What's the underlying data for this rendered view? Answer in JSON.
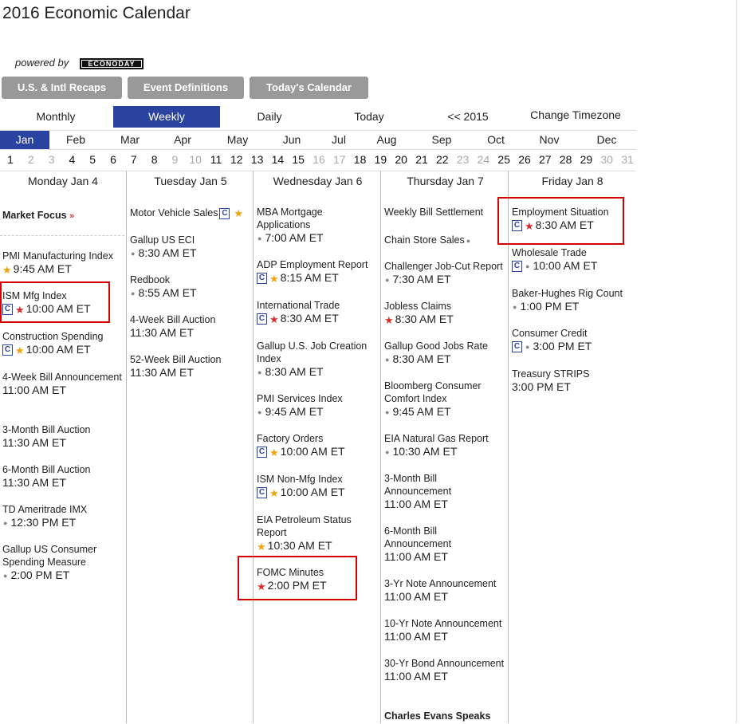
{
  "title": "2016 Economic Calendar",
  "powered_by": "powered by",
  "logo_text": "ECONODAY",
  "buttons": [
    "U.S. & Intl Recaps",
    "Event Definitions",
    "Today's Calendar"
  ],
  "views": [
    "Monthly",
    "Weekly",
    "Daily",
    "Today",
    "<< 2015",
    "Change Timezone"
  ],
  "active_view": "Weekly",
  "months": [
    "Jan",
    "Feb",
    "Mar",
    "Apr",
    "May",
    "Jun",
    "Jul",
    "Aug",
    "Sep",
    "Oct",
    "Nov",
    "Dec"
  ],
  "active_month": "Jan",
  "days": [
    {
      "n": "1",
      "dim": false
    },
    {
      "n": "2",
      "dim": true
    },
    {
      "n": "3",
      "dim": true
    },
    {
      "n": "4",
      "dim": false
    },
    {
      "n": "5",
      "dim": false
    },
    {
      "n": "6",
      "dim": false
    },
    {
      "n": "7",
      "dim": false
    },
    {
      "n": "8",
      "dim": false
    },
    {
      "n": "9",
      "dim": true
    },
    {
      "n": "10",
      "dim": true
    },
    {
      "n": "11",
      "dim": false
    },
    {
      "n": "12",
      "dim": false
    },
    {
      "n": "13",
      "dim": false
    },
    {
      "n": "14",
      "dim": false
    },
    {
      "n": "15",
      "dim": false
    },
    {
      "n": "16",
      "dim": true
    },
    {
      "n": "17",
      "dim": true
    },
    {
      "n": "18",
      "dim": false
    },
    {
      "n": "19",
      "dim": false
    },
    {
      "n": "20",
      "dim": false
    },
    {
      "n": "21",
      "dim": false
    },
    {
      "n": "22",
      "dim": false
    },
    {
      "n": "23",
      "dim": true
    },
    {
      "n": "24",
      "dim": true
    },
    {
      "n": "25",
      "dim": false
    },
    {
      "n": "26",
      "dim": false
    },
    {
      "n": "27",
      "dim": false
    },
    {
      "n": "28",
      "dim": false
    },
    {
      "n": "29",
      "dim": false
    },
    {
      "n": "30",
      "dim": true
    },
    {
      "n": "31",
      "dim": true
    }
  ],
  "columns": [
    {
      "header": "Monday Jan 4",
      "events": [
        {
          "name": "Market Focus",
          "bold": true,
          "arrow": "»",
          "time": ""
        },
        {
          "name": "PMI Manufacturing Index",
          "icons": [
            "stary"
          ],
          "time": "9:45 AM ET"
        },
        {
          "name": "ISM Mfg Index",
          "icons": [
            "c",
            "star"
          ],
          "time": "10:00 AM ET"
        },
        {
          "name": "Construction Spending",
          "icons": [
            "c",
            "stary"
          ],
          "time": "10:00 AM ET"
        },
        {
          "name": "4-Week Bill Announcement",
          "icons": [],
          "time": "11:00 AM ET"
        },
        {
          "name": "3-Month Bill Auction",
          "icons": [],
          "time": "11:30 AM ET"
        },
        {
          "name": "6-Month Bill Auction",
          "icons": [],
          "time": "11:30 AM ET"
        },
        {
          "name": "TD Ameritrade IMX",
          "icons": [
            "dot"
          ],
          "time": "12:30 PM ET"
        },
        {
          "name": "Gallup US Consumer Spending Measure",
          "icons": [
            "dot"
          ],
          "time": "2:00 PM ET"
        }
      ]
    },
    {
      "header": "Tuesday Jan 5",
      "events": [
        {
          "name": "Motor Vehicle Sales",
          "inline_icons": [
            "c",
            "stary"
          ],
          "time": ""
        },
        {
          "name": "Gallup US ECI",
          "icons": [
            "dot"
          ],
          "time": "8:30 AM ET"
        },
        {
          "name": "Redbook",
          "icons": [
            "dot"
          ],
          "time": "8:55 AM ET"
        },
        {
          "name": "4-Week Bill Auction",
          "icons": [],
          "time": "11:30 AM ET"
        },
        {
          "name": "52-Week Bill Auction",
          "icons": [],
          "time": "11:30 AM ET"
        }
      ]
    },
    {
      "header": "Wednesday Jan 6",
      "events": [
        {
          "name": "MBA Mortgage Applications",
          "icons": [
            "dot"
          ],
          "time": "7:00 AM ET"
        },
        {
          "name": "ADP Employment Report",
          "icons": [
            "c",
            "stary"
          ],
          "time": "8:15 AM ET"
        },
        {
          "name": "International Trade",
          "icons": [
            "c",
            "star"
          ],
          "time": "8:30 AM ET"
        },
        {
          "name": "Gallup U.S. Job Creation Index",
          "icons": [
            "dot"
          ],
          "time": "8:30 AM ET"
        },
        {
          "name": "PMI Services Index",
          "icons": [
            "dot"
          ],
          "time": "9:45 AM ET"
        },
        {
          "name": "Factory Orders",
          "icons": [
            "c",
            "stary"
          ],
          "time": "10:00 AM ET"
        },
        {
          "name": "ISM Non-Mfg Index",
          "icons": [
            "c",
            "stary"
          ],
          "time": "10:00 AM ET"
        },
        {
          "name": "EIA Petroleum Status Report",
          "icons": [
            "stary"
          ],
          "time": "10:30 AM ET"
        },
        {
          "name": "FOMC Minutes",
          "icons": [
            "star"
          ],
          "time": "2:00 PM ET"
        }
      ]
    },
    {
      "header": "Thursday Jan 7",
      "events": [
        {
          "name": "Weekly Bill Settlement",
          "icons": [],
          "time": ""
        },
        {
          "name": "Chain Store Sales",
          "inline_icons": [
            "dot"
          ],
          "time": ""
        },
        {
          "name": "Challenger Job-Cut Report",
          "icons": [
            "dot"
          ],
          "time": "7:30 AM ET"
        },
        {
          "name": "Jobless Claims",
          "icons": [
            "star"
          ],
          "time": "8:30 AM ET"
        },
        {
          "name": "Gallup Good Jobs Rate",
          "icons": [
            "dot"
          ],
          "time": "8:30 AM ET"
        },
        {
          "name": "Bloomberg Consumer Comfort Index",
          "icons": [
            "dot"
          ],
          "time": "9:45 AM ET"
        },
        {
          "name": "EIA Natural Gas Report",
          "icons": [
            "dot"
          ],
          "time": "10:30 AM ET"
        },
        {
          "name": "3-Month Bill Announcement",
          "icons": [],
          "time": "11:00 AM ET"
        },
        {
          "name": "6-Month Bill Announcement",
          "icons": [],
          "time": "11:00 AM ET"
        },
        {
          "name": "3-Yr Note Announcement",
          "icons": [],
          "time": "11:00 AM ET"
        },
        {
          "name": "10-Yr Note Announcement",
          "icons": [],
          "time": "11:00 AM ET"
        },
        {
          "name": "30-Yr Bond Announcement",
          "icons": [],
          "time": "11:00 AM ET"
        },
        {
          "name": "Charles Evans Speaks",
          "bold": true,
          "time": ""
        }
      ]
    },
    {
      "header": "Friday Jan 8",
      "events": [
        {
          "name": "Employment Situation",
          "icons": [
            "c",
            "star"
          ],
          "time": "8:30 AM ET"
        },
        {
          "name": "Wholesale Trade",
          "icons": [
            "c",
            "dot"
          ],
          "time": "10:00 AM ET"
        },
        {
          "name": "Baker-Hughes Rig Count",
          "icons": [
            "dot"
          ],
          "time": "1:00 PM ET"
        },
        {
          "name": "Consumer Credit",
          "icons": [
            "c",
            "dot"
          ],
          "time": "3:00 PM ET"
        },
        {
          "name": "Treasury STRIPS",
          "icons": [],
          "time": "3:00 PM ET"
        }
      ]
    }
  ]
}
